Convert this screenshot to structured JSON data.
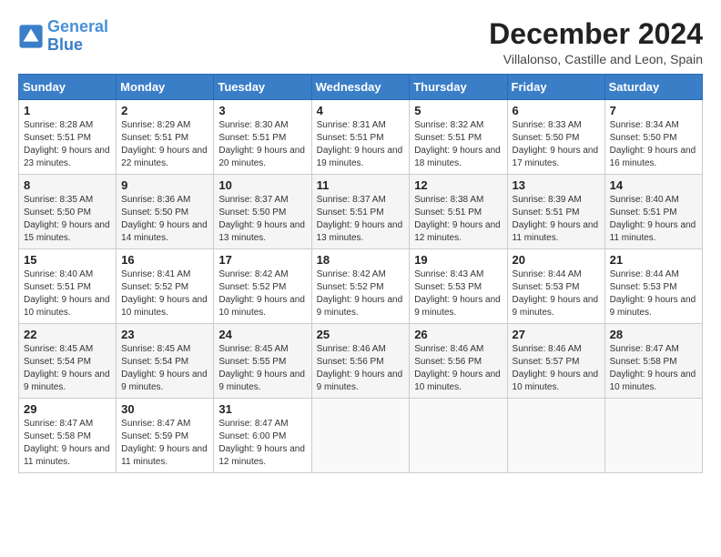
{
  "logo": {
    "text_general": "General",
    "text_blue": "Blue"
  },
  "header": {
    "month": "December 2024",
    "location": "Villalonso, Castille and Leon, Spain"
  },
  "weekdays": [
    "Sunday",
    "Monday",
    "Tuesday",
    "Wednesday",
    "Thursday",
    "Friday",
    "Saturday"
  ],
  "weeks": [
    [
      {
        "day": "1",
        "sunrise": "8:28 AM",
        "sunset": "5:51 PM",
        "daylight": "9 hours and 23 minutes"
      },
      {
        "day": "2",
        "sunrise": "8:29 AM",
        "sunset": "5:51 PM",
        "daylight": "9 hours and 22 minutes"
      },
      {
        "day": "3",
        "sunrise": "8:30 AM",
        "sunset": "5:51 PM",
        "daylight": "9 hours and 20 minutes"
      },
      {
        "day": "4",
        "sunrise": "8:31 AM",
        "sunset": "5:51 PM",
        "daylight": "9 hours and 19 minutes"
      },
      {
        "day": "5",
        "sunrise": "8:32 AM",
        "sunset": "5:51 PM",
        "daylight": "9 hours and 18 minutes"
      },
      {
        "day": "6",
        "sunrise": "8:33 AM",
        "sunset": "5:50 PM",
        "daylight": "9 hours and 17 minutes"
      },
      {
        "day": "7",
        "sunrise": "8:34 AM",
        "sunset": "5:50 PM",
        "daylight": "9 hours and 16 minutes"
      }
    ],
    [
      {
        "day": "8",
        "sunrise": "8:35 AM",
        "sunset": "5:50 PM",
        "daylight": "9 hours and 15 minutes"
      },
      {
        "day": "9",
        "sunrise": "8:36 AM",
        "sunset": "5:50 PM",
        "daylight": "9 hours and 14 minutes"
      },
      {
        "day": "10",
        "sunrise": "8:37 AM",
        "sunset": "5:50 PM",
        "daylight": "9 hours and 13 minutes"
      },
      {
        "day": "11",
        "sunrise": "8:37 AM",
        "sunset": "5:51 PM",
        "daylight": "9 hours and 13 minutes"
      },
      {
        "day": "12",
        "sunrise": "8:38 AM",
        "sunset": "5:51 PM",
        "daylight": "9 hours and 12 minutes"
      },
      {
        "day": "13",
        "sunrise": "8:39 AM",
        "sunset": "5:51 PM",
        "daylight": "9 hours and 11 minutes"
      },
      {
        "day": "14",
        "sunrise": "8:40 AM",
        "sunset": "5:51 PM",
        "daylight": "9 hours and 11 minutes"
      }
    ],
    [
      {
        "day": "15",
        "sunrise": "8:40 AM",
        "sunset": "5:51 PM",
        "daylight": "9 hours and 10 minutes"
      },
      {
        "day": "16",
        "sunrise": "8:41 AM",
        "sunset": "5:52 PM",
        "daylight": "9 hours and 10 minutes"
      },
      {
        "day": "17",
        "sunrise": "8:42 AM",
        "sunset": "5:52 PM",
        "daylight": "9 hours and 10 minutes"
      },
      {
        "day": "18",
        "sunrise": "8:42 AM",
        "sunset": "5:52 PM",
        "daylight": "9 hours and 9 minutes"
      },
      {
        "day": "19",
        "sunrise": "8:43 AM",
        "sunset": "5:53 PM",
        "daylight": "9 hours and 9 minutes"
      },
      {
        "day": "20",
        "sunrise": "8:44 AM",
        "sunset": "5:53 PM",
        "daylight": "9 hours and 9 minutes"
      },
      {
        "day": "21",
        "sunrise": "8:44 AM",
        "sunset": "5:53 PM",
        "daylight": "9 hours and 9 minutes"
      }
    ],
    [
      {
        "day": "22",
        "sunrise": "8:45 AM",
        "sunset": "5:54 PM",
        "daylight": "9 hours and 9 minutes"
      },
      {
        "day": "23",
        "sunrise": "8:45 AM",
        "sunset": "5:54 PM",
        "daylight": "9 hours and 9 minutes"
      },
      {
        "day": "24",
        "sunrise": "8:45 AM",
        "sunset": "5:55 PM",
        "daylight": "9 hours and 9 minutes"
      },
      {
        "day": "25",
        "sunrise": "8:46 AM",
        "sunset": "5:56 PM",
        "daylight": "9 hours and 9 minutes"
      },
      {
        "day": "26",
        "sunrise": "8:46 AM",
        "sunset": "5:56 PM",
        "daylight": "9 hours and 10 minutes"
      },
      {
        "day": "27",
        "sunrise": "8:46 AM",
        "sunset": "5:57 PM",
        "daylight": "9 hours and 10 minutes"
      },
      {
        "day": "28",
        "sunrise": "8:47 AM",
        "sunset": "5:58 PM",
        "daylight": "9 hours and 10 minutes"
      }
    ],
    [
      {
        "day": "29",
        "sunrise": "8:47 AM",
        "sunset": "5:58 PM",
        "daylight": "9 hours and 11 minutes"
      },
      {
        "day": "30",
        "sunrise": "8:47 AM",
        "sunset": "5:59 PM",
        "daylight": "9 hours and 11 minutes"
      },
      {
        "day": "31",
        "sunrise": "8:47 AM",
        "sunset": "6:00 PM",
        "daylight": "9 hours and 12 minutes"
      },
      null,
      null,
      null,
      null
    ]
  ]
}
